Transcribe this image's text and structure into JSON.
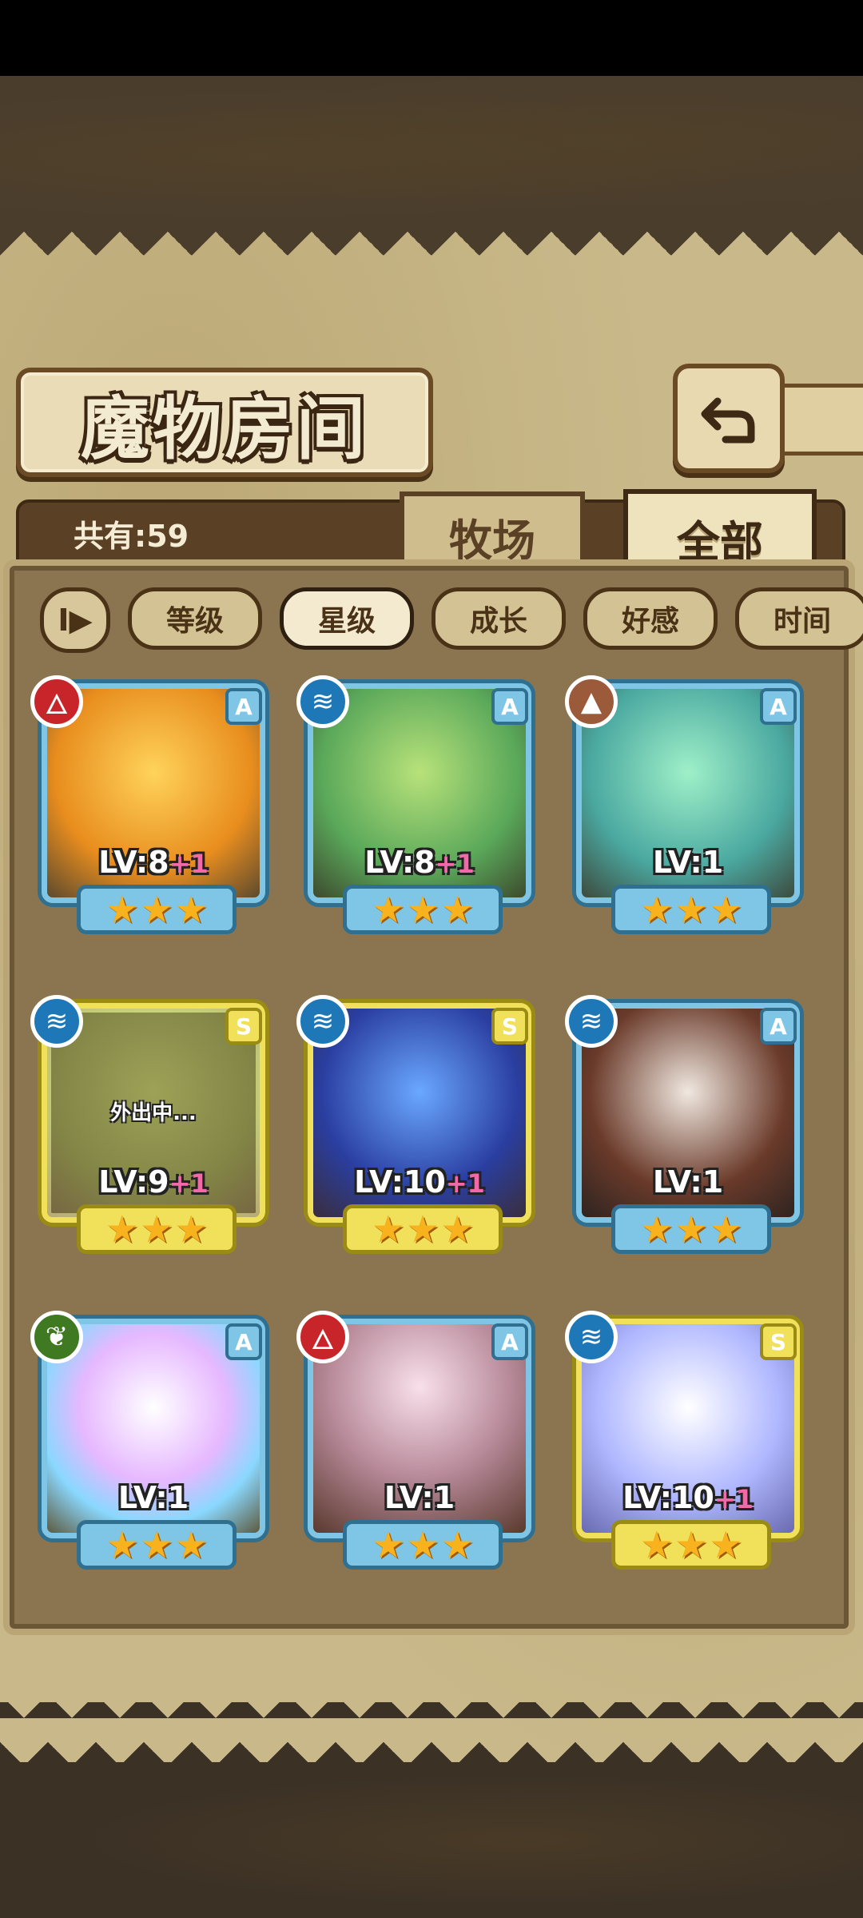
{
  "screen": {
    "title": "魔物房间",
    "count_label": "共有:59"
  },
  "tabs": [
    {
      "label": "牧场",
      "active": false
    },
    {
      "label": "全部",
      "active": true
    }
  ],
  "sort": {
    "toggle_label": "I▶",
    "options": [
      {
        "label": "等级",
        "active": false
      },
      {
        "label": "星级",
        "active": true
      },
      {
        "label": "成长",
        "active": false
      },
      {
        "label": "好感",
        "active": false
      },
      {
        "label": "时间",
        "active": false
      }
    ]
  },
  "monsters": [
    {
      "element": "fire",
      "rank": "A",
      "level": "LV:8",
      "plus": "+1",
      "stars": 3,
      "away": ""
    },
    {
      "element": "water",
      "rank": "A",
      "level": "LV:8",
      "plus": "+1",
      "stars": 3,
      "away": ""
    },
    {
      "element": "earth",
      "rank": "A",
      "level": "LV:1",
      "plus": "",
      "stars": 3,
      "away": ""
    },
    {
      "element": "water",
      "rank": "S",
      "level": "LV:9",
      "plus": "+1",
      "stars": 3,
      "away": "外出中..."
    },
    {
      "element": "water",
      "rank": "S",
      "level": "LV:10",
      "plus": "+1",
      "stars": 3,
      "away": ""
    },
    {
      "element": "water",
      "rank": "A",
      "level": "LV:1",
      "plus": "",
      "stars": 3,
      "away": ""
    },
    {
      "element": "grass",
      "rank": "A",
      "level": "LV:1",
      "plus": "",
      "stars": 3,
      "away": ""
    },
    {
      "element": "fire",
      "rank": "A",
      "level": "LV:1",
      "plus": "",
      "stars": 3,
      "away": ""
    },
    {
      "element": "water",
      "rank": "S",
      "level": "LV:10",
      "plus": "+1",
      "stars": 3,
      "away": ""
    }
  ],
  "colors": {
    "fire": "#c8252a",
    "water": "#1e78b8",
    "earth": "#9b5a3a",
    "grass": "#3f7a22",
    "rank_A_frame": "#7fc6e6",
    "rank_S_frame": "#f0e05a"
  },
  "icons": {
    "back": "return-arrow-icon",
    "fire": "flame-icon",
    "water": "water-waves-icon",
    "earth": "mountain-icon",
    "grass": "leaf-icon",
    "star": "star-icon"
  }
}
